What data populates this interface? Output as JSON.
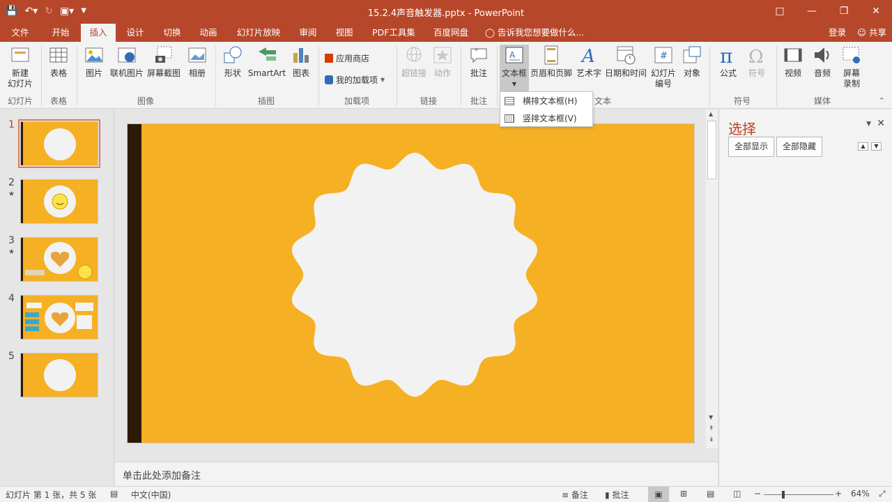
{
  "window": {
    "title": "15.2.4声音触发器.pptx - PowerPoint"
  },
  "qat": {
    "save_icon": "save-icon",
    "undo_icon": "undo-icon",
    "redo_icon": "redo-icon",
    "presenter_icon": "start-from-beginning-icon",
    "customize_icon": "customize-qat-icon"
  },
  "tabs": [
    {
      "label": "文件"
    },
    {
      "label": "开始"
    },
    {
      "label": "插入"
    },
    {
      "label": "设计"
    },
    {
      "label": "切换"
    },
    {
      "label": "动画"
    },
    {
      "label": "幻灯片放映"
    },
    {
      "label": "审阅"
    },
    {
      "label": "视图"
    },
    {
      "label": "PDF工具集"
    },
    {
      "label": "百度网盘"
    },
    {
      "label": "告诉我您想要做什么..."
    }
  ],
  "account": {
    "login": "登录",
    "share": "共享"
  },
  "ribbon": {
    "new_slide": "新建\n幻灯片",
    "table": "表格",
    "picture": "图片",
    "online_picture": "联机图片",
    "screenshot": "屏幕截图",
    "album": "相册",
    "shapes": "形状",
    "smartart": "SmartArt",
    "chart": "图表",
    "store": "应用商店",
    "my_addins": "我的加载项",
    "hyperlink": "超链接",
    "action": "动作",
    "comment": "批注",
    "textbox": "文本框",
    "header_footer": "页眉和页脚",
    "wordart": "艺术字",
    "datetime": "日期和时间",
    "slide_number": "幻灯片\n编号",
    "object": "对象",
    "equation": "公式",
    "symbol": "符号",
    "video": "视频",
    "audio": "音频",
    "screen_recording": "屏幕\n录制",
    "groups": {
      "slides": "幻灯片",
      "tables": "表格",
      "images": "图像",
      "illustrations": "插图",
      "addins": "加载项",
      "links": "链接",
      "comments": "批注",
      "text": "文本",
      "symbols": "符号",
      "media": "媒体"
    }
  },
  "textbox_menu": [
    {
      "label": "横排文本框(H)"
    },
    {
      "label": "竖排文本框(V)"
    }
  ],
  "slides": [
    {
      "number": "1",
      "has_animation": false,
      "active": true
    },
    {
      "number": "2",
      "has_animation": true
    },
    {
      "number": "3",
      "has_animation": true
    },
    {
      "number": "4",
      "has_animation": false
    },
    {
      "number": "5",
      "has_animation": false
    }
  ],
  "notes_placeholder": "单击此处添加备注",
  "selection_pane": {
    "title": "选择",
    "show_all": "全部显示",
    "hide_all": "全部隐藏"
  },
  "status": {
    "slide_info": "幻灯片 第 1 张，共 5 张",
    "language": "中文(中国)",
    "notes": "备注",
    "comments": "批注",
    "zoom": "64%"
  },
  "colors": {
    "accent": "#b7472a",
    "slide_bg": "#f6b023",
    "slide_bar": "#2b1a08",
    "badge_fill": "#f2f2f2"
  }
}
